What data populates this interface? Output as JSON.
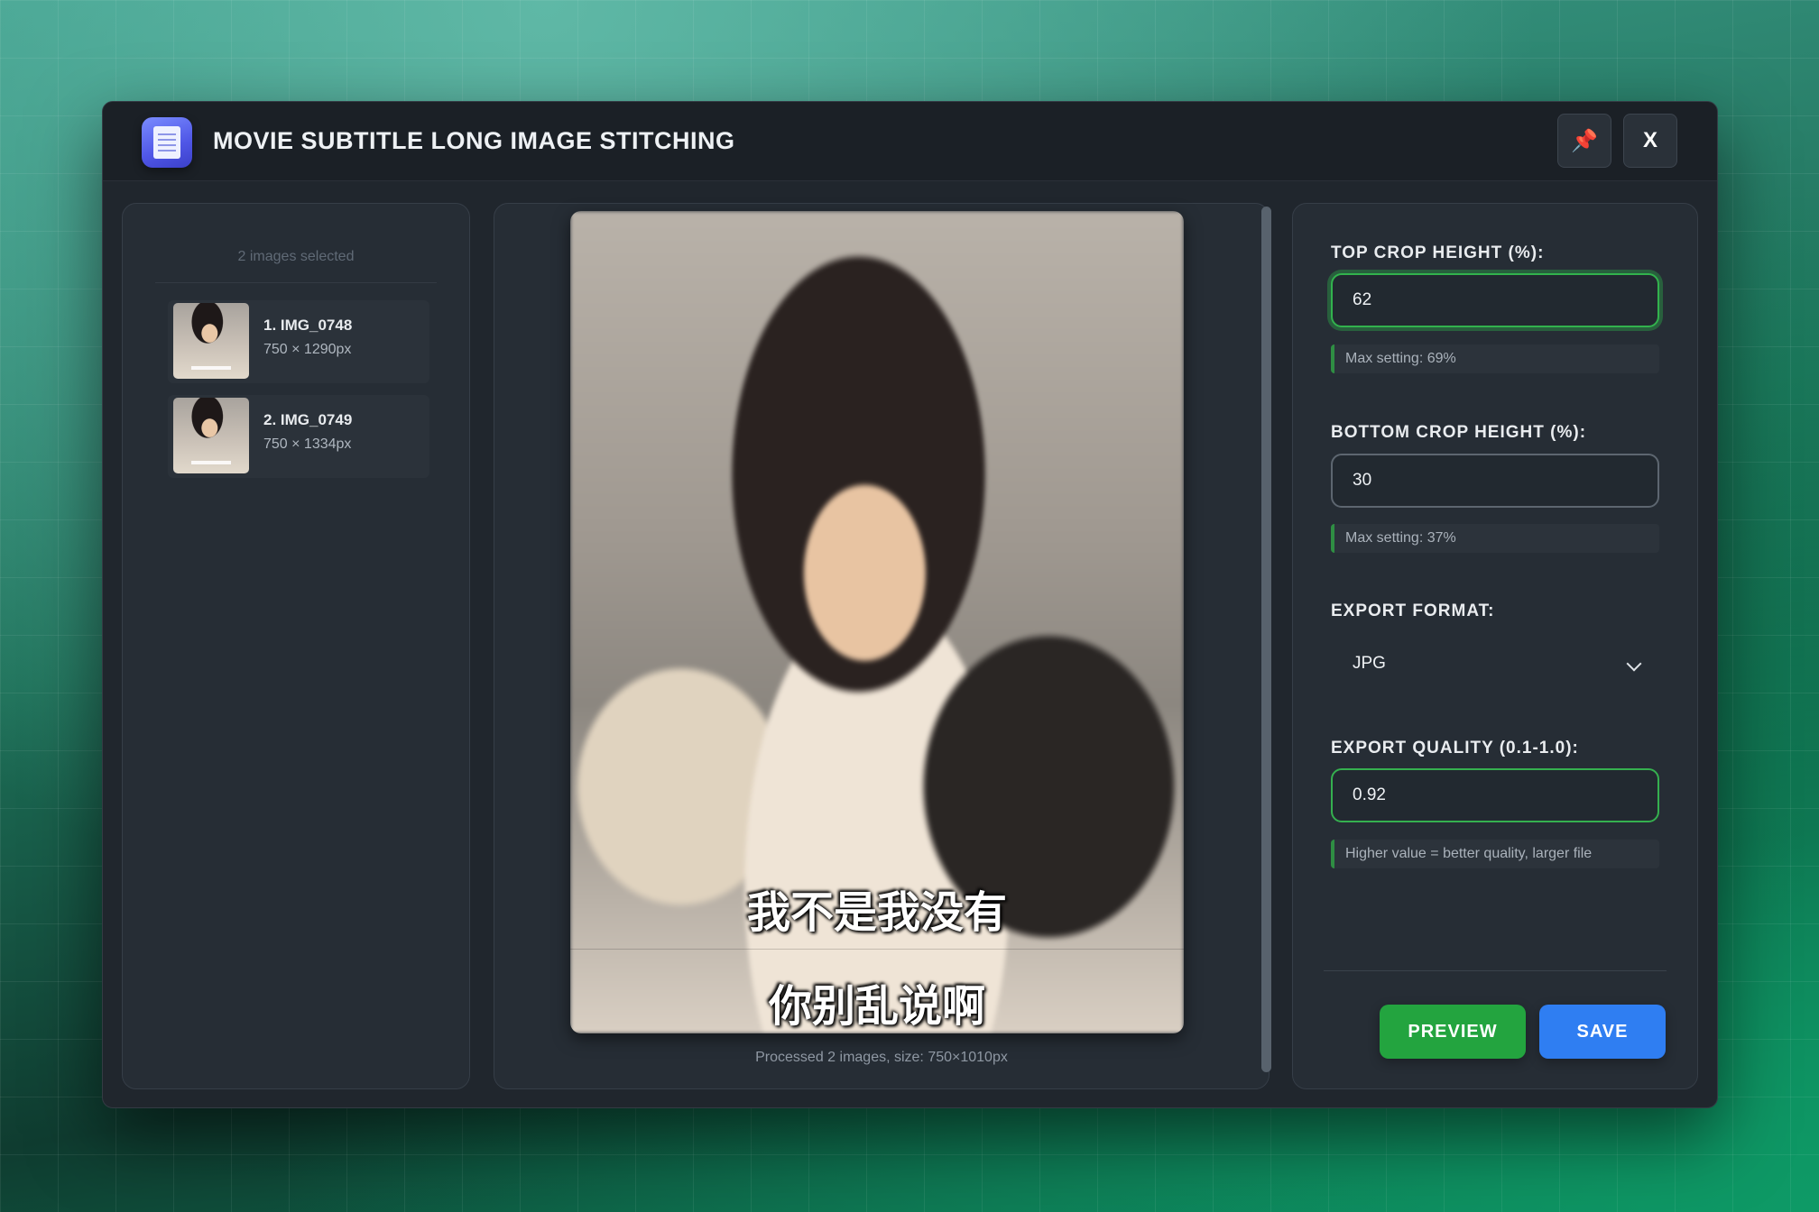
{
  "window": {
    "title": "MOVIE SUBTITLE LONG IMAGE STITCHING",
    "pin_icon": "📌",
    "close_label": "X"
  },
  "file_list": {
    "selected_count_text": "2 images selected",
    "items": [
      {
        "name": "1. IMG_0748",
        "size": "750 × 1290px"
      },
      {
        "name": "2. IMG_0749",
        "size": "750 × 1334px"
      }
    ]
  },
  "preview": {
    "subtitle_1": "我不是我没有",
    "subtitle_2": "你别乱说啊",
    "status": "Processed 2 images, size: 750×1010px"
  },
  "settings": {
    "top_crop": {
      "label": "TOP CROP HEIGHT (%):",
      "value": "62",
      "hint": "Max setting: 69%"
    },
    "bottom_crop": {
      "label": "BOTTOM CROP HEIGHT (%):",
      "value": "30",
      "hint": "Max setting: 37%"
    },
    "export_format": {
      "label": "EXPORT FORMAT:",
      "value": "JPG"
    },
    "export_quality": {
      "label": "EXPORT QUALITY (0.1-1.0):",
      "value": "0.92",
      "hint": "Higher value = better quality, larger file"
    }
  },
  "actions": {
    "preview_label": "PREVIEW",
    "save_label": "SAVE"
  },
  "colors": {
    "accent_green": "#23a43f",
    "accent_blue": "#2f7ef2",
    "window_bg": "#20262d"
  }
}
